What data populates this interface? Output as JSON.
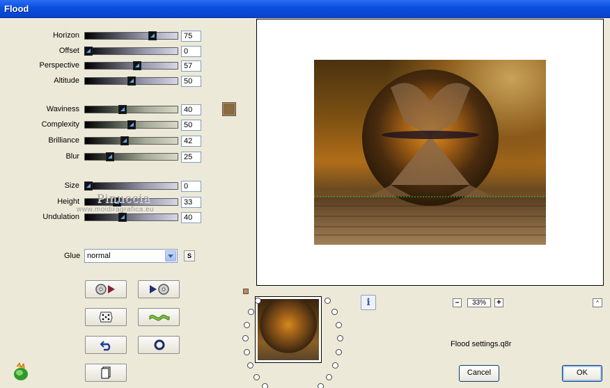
{
  "window": {
    "title": "Flood"
  },
  "sliders": [
    {
      "key": "horizon",
      "label": "Horizon",
      "value": "75",
      "level": 75,
      "style": "a"
    },
    {
      "key": "offset",
      "label": "Offset",
      "value": "0",
      "level": 0,
      "style": "a"
    },
    {
      "key": "perspective",
      "label": "Perspective",
      "value": "57",
      "level": 57,
      "style": "a"
    },
    {
      "key": "altitude",
      "label": "Altitude",
      "value": "50",
      "level": 50,
      "style": "a"
    },
    {
      "key": "waviness",
      "label": "Waviness",
      "value": "40",
      "level": 40,
      "style": "b"
    },
    {
      "key": "complexity",
      "label": "Complexity",
      "value": "50",
      "level": 50,
      "style": "b"
    },
    {
      "key": "brilliance",
      "label": "Brilliance",
      "value": "42",
      "level": 42,
      "style": "b"
    },
    {
      "key": "blur",
      "label": "Blur",
      "value": "25",
      "level": 25,
      "style": "b"
    },
    {
      "key": "size",
      "label": "Size",
      "value": "0",
      "level": 0,
      "style": "a"
    },
    {
      "key": "height",
      "label": "Height",
      "value": "33",
      "level": 33,
      "style": "a"
    },
    {
      "key": "undulation",
      "label": "Undulation",
      "value": "40",
      "level": 40,
      "style": "a"
    }
  ],
  "color_swatch": {
    "color": "#8b6a40"
  },
  "watermark": {
    "name": "Pinuccia",
    "url": "www.moidiragrafica.eu"
  },
  "glue": {
    "label": "Glue",
    "value": "normal",
    "s_label": "S"
  },
  "tool_buttons": [
    {
      "name": "load-settings-button",
      "icon": "disc-play-icon"
    },
    {
      "name": "save-settings-button",
      "icon": "play-disc-icon"
    },
    {
      "name": "randomize-button",
      "icon": "dice-icon"
    },
    {
      "name": "wave-button",
      "icon": "wave-icon"
    },
    {
      "name": "undo-button",
      "icon": "undo-icon"
    },
    {
      "name": "reset-button",
      "icon": "ring-icon"
    },
    {
      "name": "copy-button",
      "icon": "page-icon"
    }
  ],
  "preview": {
    "zoom": "33%",
    "zoom_minus": "–",
    "zoom_plus": "+",
    "up": "^",
    "info": "i"
  },
  "settings_file": "Flood settings.q8r",
  "buttons": {
    "cancel": "Cancel",
    "ok": "OK"
  }
}
